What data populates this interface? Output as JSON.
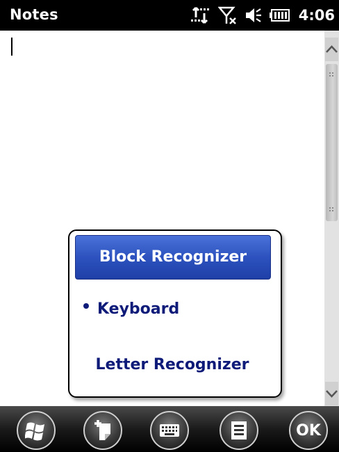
{
  "titlebar": {
    "app_title": "Notes",
    "clock": "4:06",
    "icons": [
      "connectivity-icon",
      "signal-off-icon",
      "volume-icon",
      "battery-icon"
    ]
  },
  "sip_menu": {
    "items": [
      {
        "label": "Block Recognizer",
        "highlighted": true
      },
      {
        "label": "Keyboard",
        "active": true
      },
      {
        "label": "Letter Recognizer"
      }
    ]
  },
  "menubar": {
    "ok_label": "OK",
    "buttons": [
      "start-button",
      "new-note-button",
      "input-panel-button",
      "menu-button",
      "ok-button"
    ]
  },
  "colors": {
    "highlight": "#2d52bf",
    "menu_text": "#0f1b78",
    "bar": "#000000"
  }
}
